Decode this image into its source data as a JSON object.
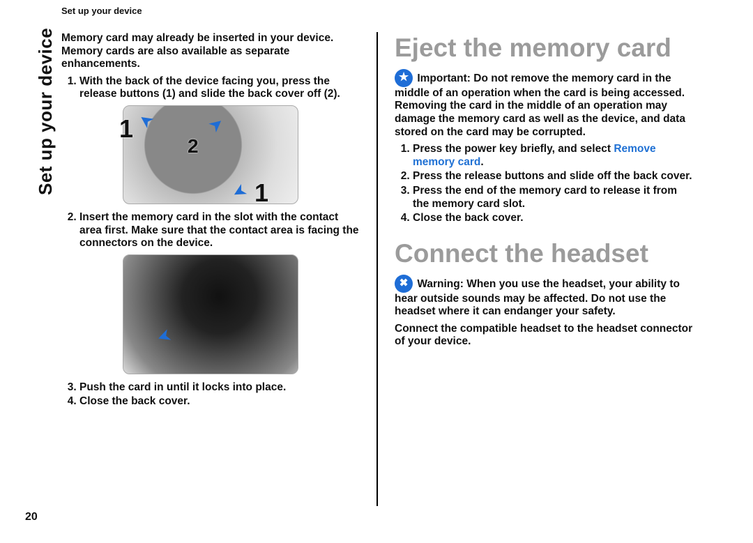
{
  "running_head": "Set up your device",
  "side_title": "Set up your device",
  "page_number": "20",
  "left": {
    "intro": "Memory card may already be inserted in your device. Memory cards are also available as separate enhancements.",
    "steps": {
      "s1": "With the back of the device facing you, press the release buttons (1) and slide the back cover off (2).",
      "s2": "Insert the memory card in the slot with the contact area first. Make sure that the contact area is facing the connectors on the device.",
      "s3": "Push the card in until it locks into place.",
      "s4": "Close the back cover."
    },
    "fig1_labels": {
      "a": "1",
      "b": "1",
      "c": "2"
    }
  },
  "right": {
    "h_eject": "Eject the memory card",
    "important_label": "Important:",
    "important_text": " Do not remove the memory card in the middle of an operation when the card is being accessed. Removing the card in the middle of an operation may damage the memory card as well as the device, and data stored on the card may be corrupted.",
    "eject_steps": {
      "s1_a": "Press the power key briefly, and select ",
      "s1_link": "Remove memory card",
      "s1_b": ".",
      "s2": "Press the release buttons and slide off the back cover.",
      "s3": "Press the end of the memory card to release it from the memory card slot.",
      "s4": "Close the back cover."
    },
    "h_headset": "Connect the headset",
    "warning_label": "Warning:",
    "warning_text": " When you use the headset, your ability to hear outside sounds may be affected. Do not use the headset where it can endanger your safety.",
    "headset_body": "Connect the compatible headset to the headset connector of your device."
  }
}
